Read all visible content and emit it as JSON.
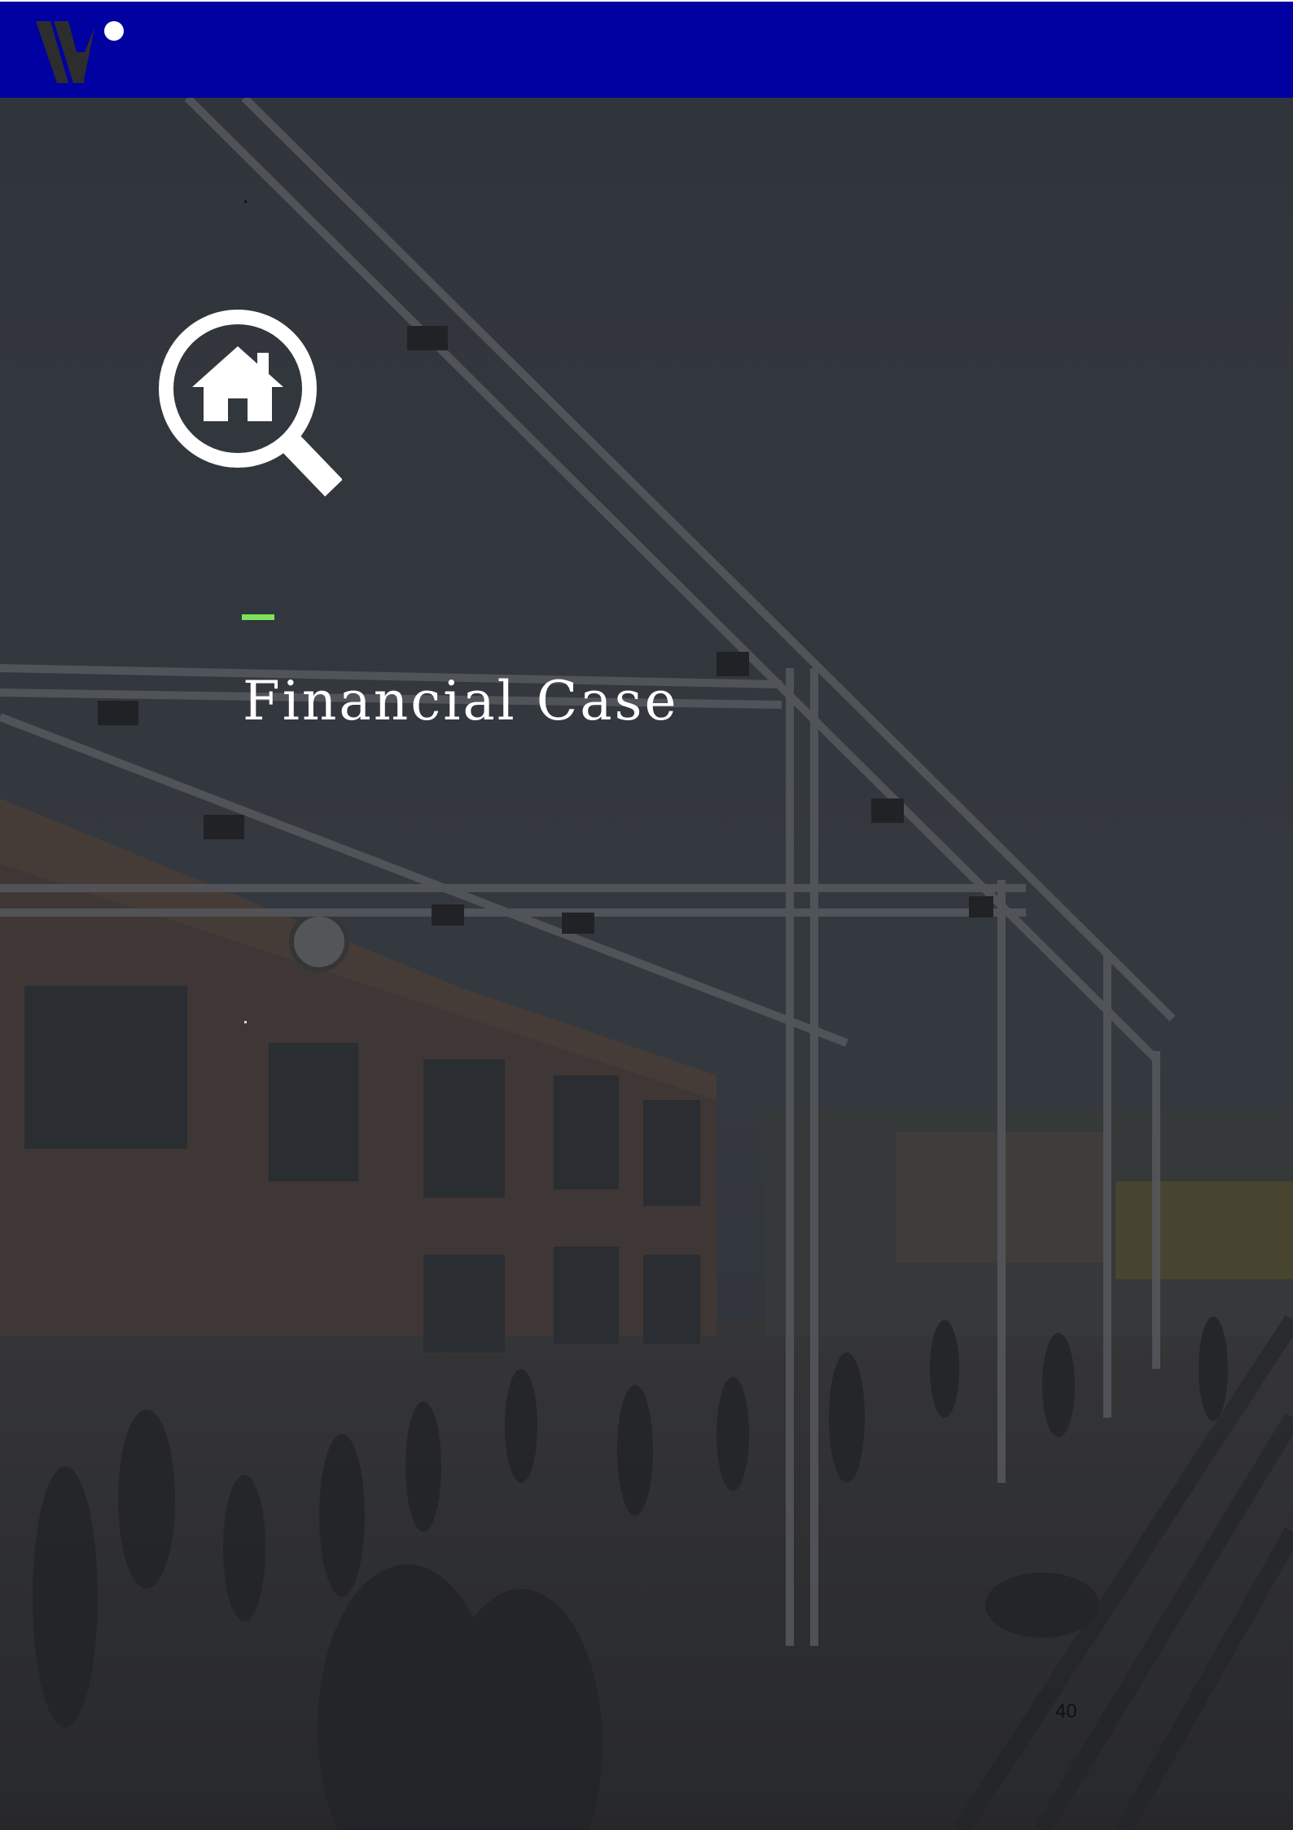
{
  "header": {
    "brand_color": "#0101a1",
    "logo_icon": "w-dot-logo-icon"
  },
  "hero": {
    "icon": "house-search-icon",
    "accent_color": "#7de35a",
    "title": "Financial Case"
  },
  "footer": {
    "page_number": "40"
  }
}
